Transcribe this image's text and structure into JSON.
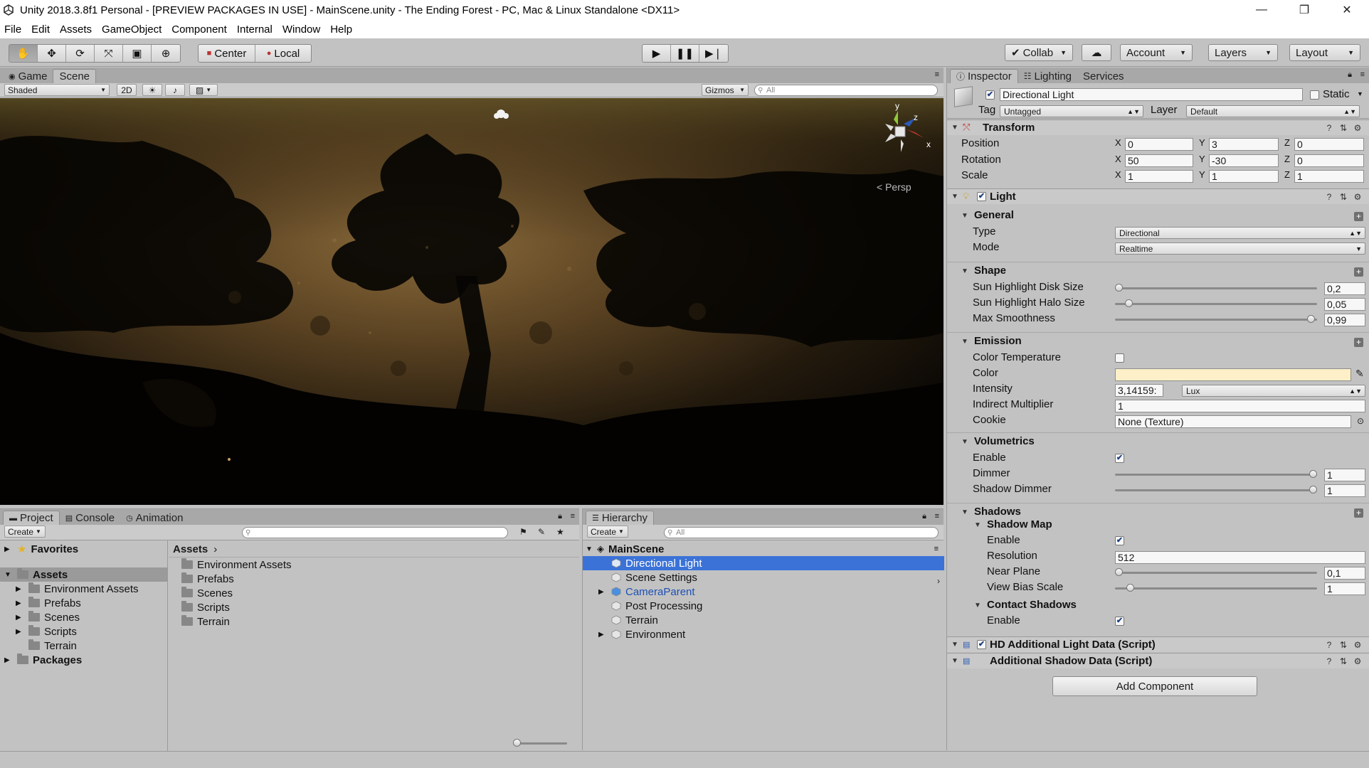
{
  "window": {
    "title": "Unity 2018.3.8f1 Personal - [PREVIEW PACKAGES IN USE] - MainScene.unity - The Ending Forest - PC, Mac & Linux Standalone <DX11>",
    "minimize": "—",
    "restore": "❐",
    "close": "✕"
  },
  "menu": [
    "File",
    "Edit",
    "Assets",
    "GameObject",
    "Component",
    "Internal",
    "Window",
    "Help"
  ],
  "toolbar": {
    "pivot": "Center",
    "space": "Local",
    "collab": "Collab",
    "account": "Account",
    "layers": "Layers",
    "layout": "Layout"
  },
  "scene_panel": {
    "tabs": [
      "Game",
      "Scene"
    ],
    "active_tab": "Scene",
    "shading": "Shaded",
    "mode2d": "2D",
    "gizmos": "Gizmos",
    "search_placeholder": "All",
    "persp_label": "Persp",
    "axis_x": "x",
    "axis_y": "y",
    "axis_z": "z"
  },
  "inspector": {
    "tabs": [
      "Inspector",
      "Lighting",
      "Services"
    ],
    "object_name": "Directional Light",
    "static_label": "Static",
    "tag_label": "Tag",
    "tag_value": "Untagged",
    "layer_label": "Layer",
    "layer_value": "Default",
    "transform": {
      "title": "Transform",
      "rows": [
        {
          "label": "Position",
          "x": "0",
          "y": "3",
          "z": "0"
        },
        {
          "label": "Rotation",
          "x": "50",
          "y": "-30",
          "z": "0"
        },
        {
          "label": "Scale",
          "x": "1",
          "y": "1",
          "z": "1"
        }
      ],
      "x_label": "X",
      "y_label": "Y",
      "z_label": "Z"
    },
    "light": {
      "title": "Light",
      "general_title": "General",
      "type_label": "Type",
      "type_value": "Directional",
      "mode_label": "Mode",
      "mode_value": "Realtime",
      "shape_title": "Shape",
      "disk_label": "Sun Highlight Disk Size",
      "disk_value": "0,2",
      "disk_level": 0.0,
      "halo_label": "Sun Highlight Halo Size",
      "halo_value": "0,05",
      "halo_level": 0.05,
      "smooth_label": "Max Smoothness",
      "smooth_value": "0,99",
      "smooth_level": 0.99,
      "emission_title": "Emission",
      "colortemp_label": "Color Temperature",
      "color_label": "Color",
      "color_value_hex": "#fdf0c9",
      "intensity_label": "Intensity",
      "intensity_value": "3,14159:",
      "intensity_unit": "Lux",
      "indirect_label": "Indirect Multiplier",
      "indirect_value": "1",
      "cookie_label": "Cookie",
      "cookie_value": "None (Texture)",
      "volumetrics_title": "Volumetrics",
      "vol_enable_label": "Enable",
      "dimmer_label": "Dimmer",
      "dimmer_value": "1",
      "dimmer_level": 1.0,
      "shadow_dimmer_label": "Shadow Dimmer",
      "shadow_dimmer_value": "1",
      "shadow_dimmer_level": 1.0,
      "shadows_title": "Shadows",
      "shadowmap_title": "Shadow Map",
      "sm_enable_label": "Enable",
      "resolution_label": "Resolution",
      "resolution_value": "512",
      "near_label": "Near Plane",
      "near_value": "0,1",
      "near_level": 0.0,
      "bias_label": "View Bias Scale",
      "bias_value": "1",
      "bias_level": 0.06,
      "contact_title": "Contact Shadows",
      "cs_enable_label": "Enable"
    },
    "hd_component": "HD Additional Light Data (Script)",
    "shadow_component": "Additional Shadow Data (Script)",
    "add_component": "Add Component"
  },
  "project": {
    "tabs": [
      "Project",
      "Console",
      "Animation"
    ],
    "create": "Create",
    "favorites": "Favorites",
    "assets": "Assets",
    "tree": [
      "Environment Assets",
      "Prefabs",
      "Scenes",
      "Scripts",
      "Terrain"
    ],
    "packages": "Packages",
    "breadcrumb": "Assets",
    "files": [
      "Environment Assets",
      "Prefabs",
      "Scenes",
      "Scripts",
      "Terrain"
    ]
  },
  "hierarchy": {
    "tab": "Hierarchy",
    "create": "Create",
    "search_placeholder": "All",
    "scene": "MainScene",
    "items": [
      {
        "label": "Directional Light",
        "selected": true,
        "expandable": false,
        "prefab": false
      },
      {
        "label": "Scene Settings",
        "selected": false,
        "expandable": false,
        "prefab": false
      },
      {
        "label": "CameraParent",
        "selected": false,
        "expandable": true,
        "prefab": true
      },
      {
        "label": "Post Processing",
        "selected": false,
        "expandable": false,
        "prefab": false
      },
      {
        "label": "Terrain",
        "selected": false,
        "expandable": false,
        "prefab": false
      },
      {
        "label": "Environment",
        "selected": false,
        "expandable": true,
        "prefab": false
      }
    ]
  },
  "colors": {
    "selection": "#3a72d8",
    "prefab_text": "#1d4fb3",
    "panel_bg": "#c2c2c2"
  }
}
